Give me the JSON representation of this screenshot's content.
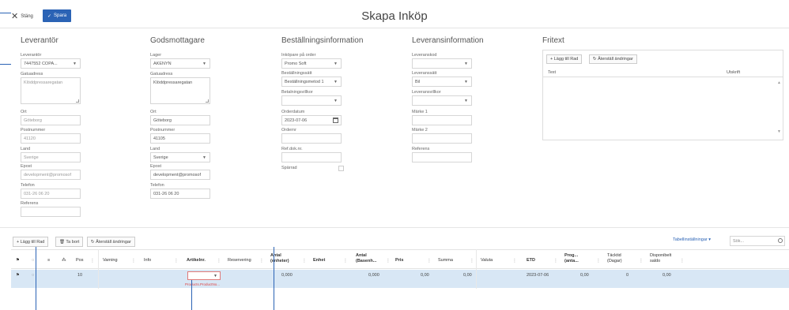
{
  "toolbar": {
    "close_label": "Stäng",
    "save_label": "Spara"
  },
  "page_title": "Skapa Inköp",
  "supplier": {
    "title": "Leverantör",
    "supplier_label": "Leverantör",
    "supplier_value": "7447552 COPA...",
    "address_label": "Gatuadress",
    "address_value": "Klöddpressaregatan",
    "city_label": "Ort",
    "city_value": "Göteborg",
    "zip_label": "Postnummer",
    "zip_value": "41120",
    "country_label": "Land",
    "country_value": "Sverige",
    "email_label": "Epost",
    "email_value": "development@promosof",
    "phone_label": "Telefon",
    "phone_value": "031-26 06 20",
    "ref_label": "Referens",
    "ref_value": ""
  },
  "consignee": {
    "title": "Godsmottagare",
    "stock_label": "Lager",
    "stock_value": "AKENYN",
    "address_label": "Gatuadress",
    "address_value": "Klöddpressaregatan",
    "city_label": "Ort",
    "city_value": "Göteborg",
    "zip_label": "Postnummer",
    "zip_value": "41105",
    "country_label": "Land",
    "country_value": "Sverige",
    "email_label": "Epost",
    "email_value": "development@promosof",
    "phone_label": "Telefon",
    "phone_value": "031-26 06 20"
  },
  "order": {
    "title": "Beställningsinformation",
    "buyer_label": "Inköpare på order",
    "buyer_value": "Promo Soft",
    "method_label": "Beställningssätt",
    "method_value": "Beställningsmetod 1",
    "terms_label": "Betalningsvillkor",
    "terms_value": "",
    "date_label": "Orderdatum",
    "date_value": "2023-07-06",
    "ordernr_label": "Ordernr",
    "ordernr_value": "",
    "refdoc_label": "Ref.dok.nr.",
    "refdoc_value": "",
    "locked_label": "Spärrad"
  },
  "delivery": {
    "title": "Leveransinformation",
    "code_label": "Leveranskod",
    "code_value": "",
    "method_label": "Leveranssätt",
    "method_value": "Bil",
    "terms_label": "Leveransvillkor",
    "terms_value": "",
    "mark1_label": "Märke 1",
    "mark1_value": "",
    "mark2_label": "Märke 2",
    "mark2_value": "",
    "ref_label": "Referens",
    "ref_value": ""
  },
  "fritext": {
    "title": "Fritext",
    "add_label": "+ Lägg till Rad",
    "reset_label": "Återställ ändringar",
    "col_text": "Text",
    "col_print": "Utskrift"
  },
  "grid_toolbar": {
    "add_label": "+ Lägg till Rad",
    "delete_label": "Ta bort",
    "reset_label": "Återställ ändringar",
    "settings_label": "Tabellinställningar ▾",
    "search_placeholder": "Sök..."
  },
  "grid": {
    "headers": {
      "pos": "Pos",
      "warning": "Varning",
      "info": "Info",
      "article": "Artikelnr.",
      "reservation": "Reservering",
      "qty_unit": "Antal (enheter)",
      "unit": "Enhet",
      "qty_base": "Antal (Basenh...",
      "price": "Pris",
      "sum": "Summa",
      "currency": "Valuta",
      "etd": "ETD",
      "prog": "Prog... (anta...",
      "lead": "Täcktid (Dagar)",
      "avail": "Disponibelt saldo"
    },
    "row": {
      "pos": "10",
      "qty_unit": "0,000",
      "qty_base": "0,000",
      "price": "0,00",
      "sum": "0,00",
      "etd": "2023-07-06",
      "prog": "0,00",
      "lead": "0",
      "avail": "0,00",
      "article_error": "Products.ProductNo..."
    }
  }
}
